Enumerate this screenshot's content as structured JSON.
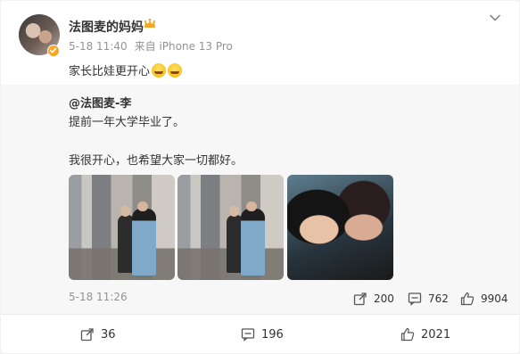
{
  "post": {
    "username": "法图麦的妈妈",
    "date": "5-18 11:40",
    "source": "来自 iPhone 13 Pro",
    "text": "家长比娃更开心"
  },
  "repost": {
    "author": "@法图麦-李",
    "line1": "提前一年大学毕业了。",
    "line2": "我很开心，也希望大家一切都好。",
    "time": "5-18 11:26",
    "reposts": "200",
    "comments": "762",
    "likes": "9904"
  },
  "actions": {
    "reposts": "36",
    "comments": "196",
    "likes": "2021"
  },
  "icons": {
    "menu": "chevron-down-icon",
    "repost": "share-icon",
    "comment": "comment-icon",
    "like": "thumbs-up-icon",
    "verified": "verified-badge-icon",
    "crown": "crown-icon"
  },
  "colors": {
    "verified_badge": "#f5a623",
    "crown": "#f5a623",
    "meta_text": "#939393"
  }
}
